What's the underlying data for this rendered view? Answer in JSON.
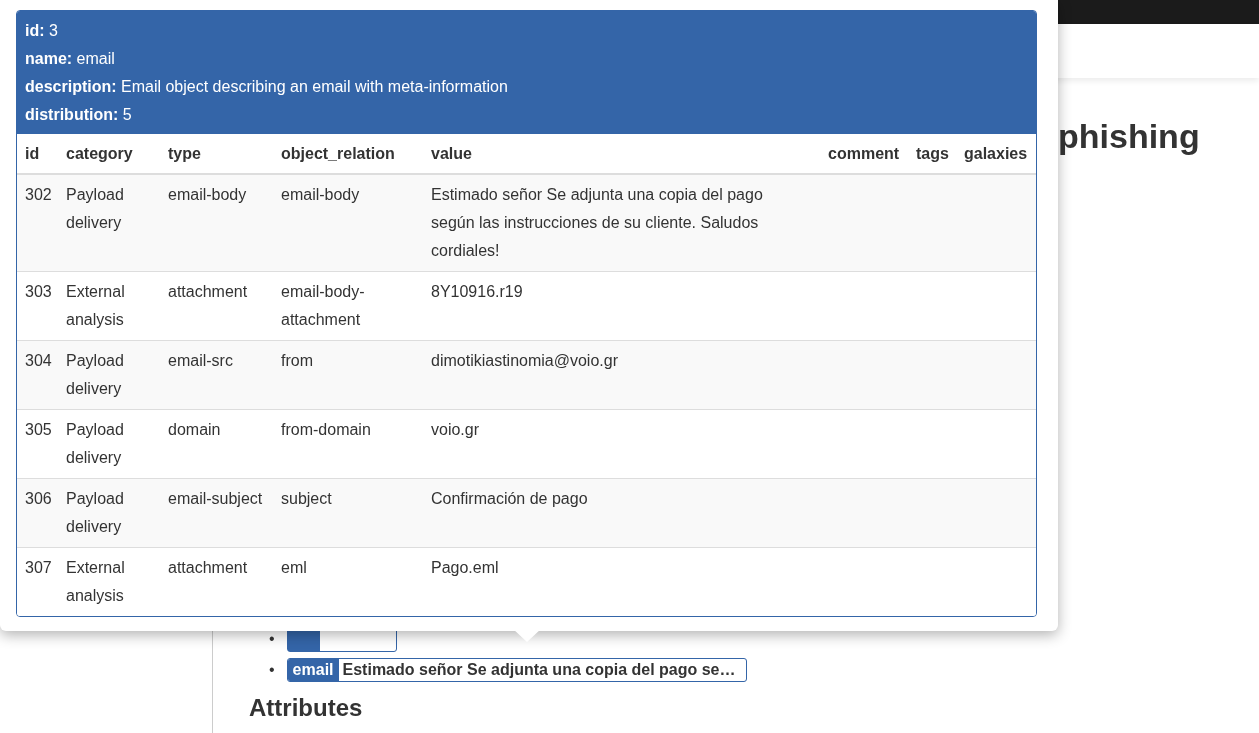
{
  "page": {
    "heading": "phishing",
    "objects": [
      {
        "bullet": "•",
        "kind": "covered"
      },
      {
        "bullet": "•",
        "kind": "tag",
        "tag": "email",
        "value": "Estimado señor Se adjunta una copia del pago se…"
      }
    ],
    "section_title": "Attributes"
  },
  "popover": {
    "fields": [
      {
        "label": "id:",
        "value": "3"
      },
      {
        "label": "name:",
        "value": "email"
      },
      {
        "label": "description:",
        "value": "Email object describing an email with meta-information"
      },
      {
        "label": "distribution:",
        "value": "5"
      }
    ],
    "columns": [
      "id",
      "category",
      "type",
      "object_relation",
      "value",
      "comment",
      "tags",
      "galaxies"
    ],
    "rows": [
      [
        "302",
        "Payload delivery",
        "email-body",
        "email-body",
        "Estimado señor Se adjunta una copia del pago según las instrucciones de su cliente. Saludos cordiales!"
      ],
      [
        "303",
        "External analysis",
        "attachment",
        "email-body-attachment",
        "8Y10916.r19"
      ],
      [
        "304",
        "Payload delivery",
        "email-src",
        "from",
        "dimotikiastinomia@voio.gr"
      ],
      [
        "305",
        "Payload delivery",
        "domain",
        "from-domain",
        "voio.gr"
      ],
      [
        "306",
        "Payload delivery",
        "email-subject",
        "subject",
        "Confirmación de pago"
      ],
      [
        "307",
        "External analysis",
        "attachment",
        "eml",
        "Pago.eml"
      ]
    ]
  }
}
